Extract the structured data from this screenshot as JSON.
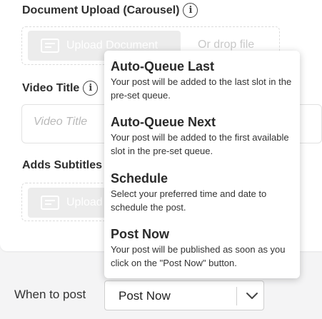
{
  "document_upload": {
    "label": "Document Upload (Carousel)",
    "upload_button": "Upload Document",
    "drop_text": "Or drop file"
  },
  "video_title": {
    "label": "Video Title",
    "placeholder": "Video Title"
  },
  "subtitles": {
    "label": "Adds Subtitles",
    "upload_button": "Upload"
  },
  "when_to_post": {
    "label": "When to post",
    "selected": "Post Now"
  },
  "menu": {
    "items": [
      {
        "title": "Auto-Queue Last",
        "description": "Your post will be added to the last slot in the pre-set queue."
      },
      {
        "title": "Auto-Queue Next",
        "description": "Your post will be added to the first available slot in the pre-set queue."
      },
      {
        "title": "Schedule",
        "description": "Select your preferred time and date to schedule the post."
      },
      {
        "title": "Post Now",
        "description": "Your post will be published as soon as you click on the \"Post Now\" button."
      }
    ]
  }
}
